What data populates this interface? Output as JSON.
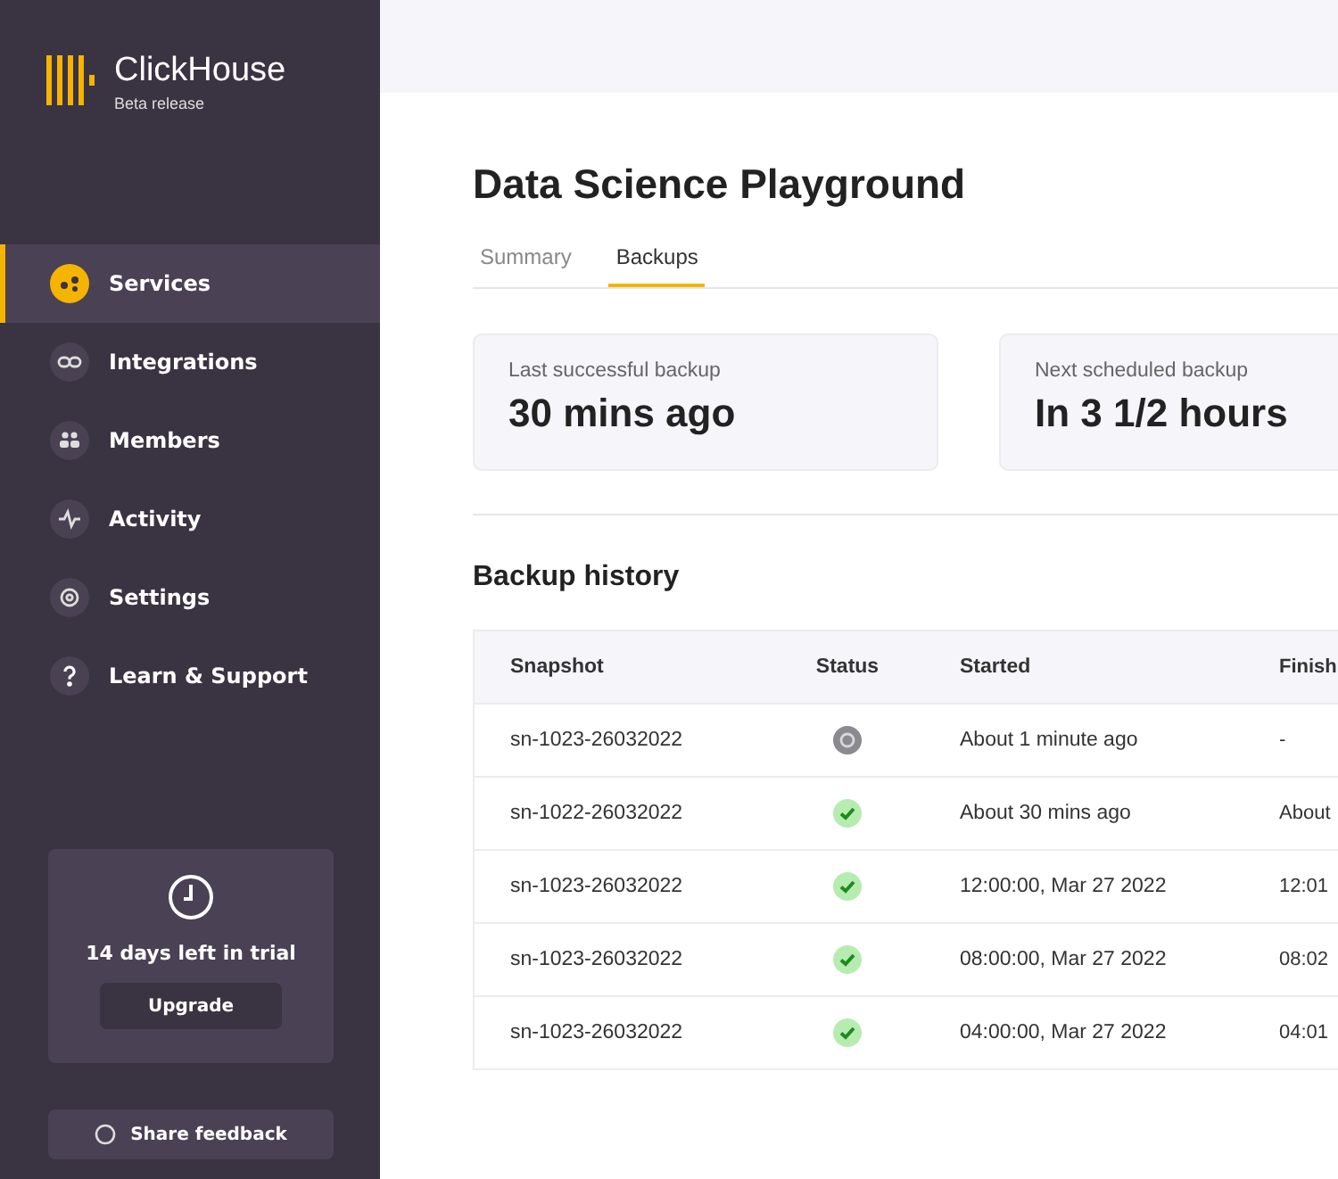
{
  "brand": {
    "name": "ClickHouse",
    "subtitle": "Beta release"
  },
  "nav": [
    {
      "label": "Services",
      "selected": true
    },
    {
      "label": "Integrations",
      "selected": false
    },
    {
      "label": "Members",
      "selected": false
    },
    {
      "label": "Activity",
      "selected": false
    },
    {
      "label": "Settings",
      "selected": false
    },
    {
      "label": "Learn & Support",
      "selected": false
    }
  ],
  "trial": {
    "text": "14 days left in trial",
    "button": "Upgrade"
  },
  "feedback": {
    "label": "Share feedback"
  },
  "page": {
    "title": "Data Science Playground"
  },
  "tabs": [
    {
      "label": "Summary",
      "selected": false
    },
    {
      "label": "Backups",
      "selected": true
    }
  ],
  "stats": [
    {
      "label": "Last successful backup",
      "value": "30 mins ago"
    },
    {
      "label": "Next scheduled backup",
      "value": "In 3 1/2 hours"
    }
  ],
  "history": {
    "title": "Backup history",
    "columns": [
      "Snapshot",
      "Status",
      "Started",
      "Finish"
    ],
    "rows": [
      {
        "snapshot": "sn-1023-26032022",
        "kind": "running",
        "started": "About 1 minute ago",
        "finished": "-"
      },
      {
        "snapshot": "sn-1022-26032022",
        "kind": "success",
        "started": "About 30 mins ago",
        "finished": "About"
      },
      {
        "snapshot": "sn-1023-26032022",
        "kind": "success",
        "started": "12:00:00, Mar 27 2022",
        "finished": "12:01"
      },
      {
        "snapshot": "sn-1023-26032022",
        "kind": "success",
        "started": "08:00:00, Mar 27 2022",
        "finished": "08:02"
      },
      {
        "snapshot": "sn-1023-26032022",
        "kind": "success",
        "started": "04:00:00, Mar 27 2022",
        "finished": "04:01"
      }
    ]
  }
}
